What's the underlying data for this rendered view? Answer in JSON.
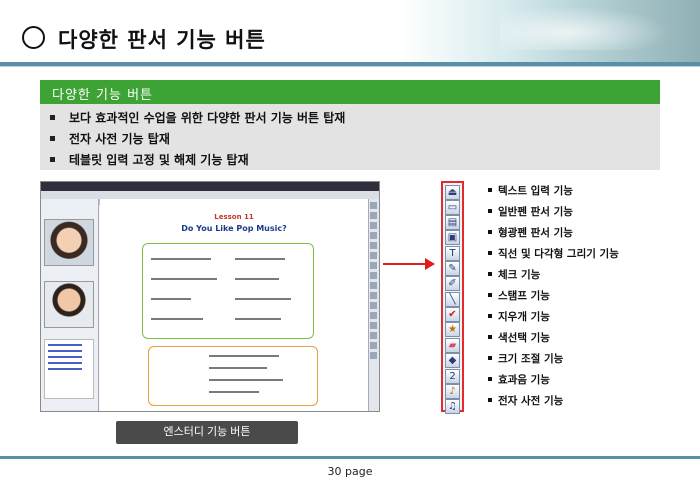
{
  "header": {
    "title": "다양한 판서 기능 버튼"
  },
  "feature_box": {
    "heading": "다양한 기능 버튼",
    "items": [
      "보다 효과적인 수업을 위한 다양한 판서 기능 버튼 탑재",
      "전자 사전 기능 탑재",
      "테블릿 입력 고정 및 해제 기능 탑재"
    ]
  },
  "screenshot": {
    "lesson_tag": "Lesson 11",
    "lesson_title": "Do You Like Pop Music?"
  },
  "caption_button": "엔스터디 기능 버튼",
  "toolbar": {
    "icons": [
      "exit-icon",
      "window-icon",
      "folder-icon",
      "save-icon",
      "text-icon",
      "pen-icon",
      "highlighter-icon",
      "line-icon",
      "check-icon",
      "stamp-icon",
      "eraser-icon",
      "color-picker-icon",
      "size-icon",
      "sound-icon",
      "music-note-icon",
      "dictionary-icon"
    ],
    "size_value": "2"
  },
  "tool_list": [
    "텍스트 입력 기능",
    "일반펜 판서 기능",
    "형광펜 판서 기능",
    "직선 및 다각형 그리기 기능",
    "체크 기능",
    "스탬프 기능",
    "지우개 기능",
    "색선택 기능",
    "크기 조절 기능",
    "효과음 기능",
    "전자 사전 기능"
  ],
  "footer": {
    "page_label": "30 page"
  },
  "colors": {
    "accent_green": "#3ea335",
    "highlight_red": "#e21b1b",
    "rule_blue": "#5a8fa6"
  }
}
